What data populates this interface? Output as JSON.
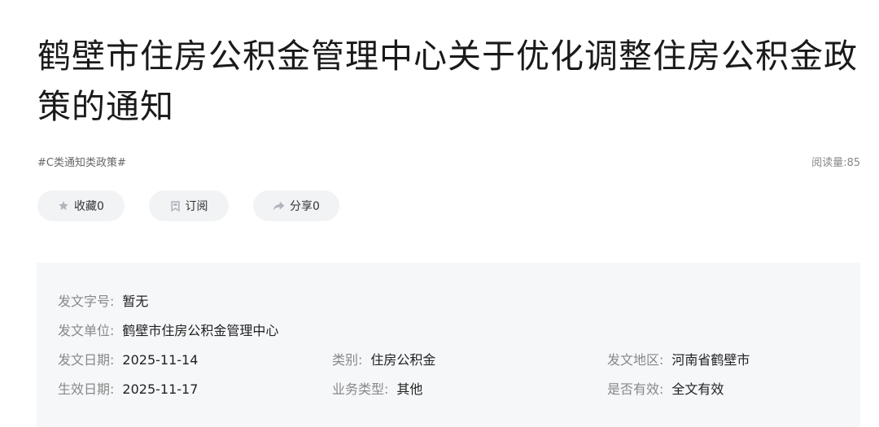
{
  "article": {
    "title": "鹤壁市住房公积金管理中心关于优化调整住房公积金政策的通知",
    "tag": "#C类通知类政策#",
    "read_count": "阅读量:85"
  },
  "actions": {
    "favorite_label": "收藏0",
    "subscribe_label": "订阅",
    "share_label": "分享0"
  },
  "info": {
    "doc_no_label": "发文字号:",
    "doc_no": "暂无",
    "issuer_label": "发文单位:",
    "issuer": "鹤壁市住房公积金管理中心",
    "issue_date_label": "发文日期:",
    "issue_date": "2025-11-14",
    "category_label": "类别:",
    "category": "住房公积金",
    "region_label": "发文地区:",
    "region": "河南省鹤壁市",
    "effective_date_label": "生效日期:",
    "effective_date": "2025-11-17",
    "business_type_label": "业务类型:",
    "business_type": "其他",
    "valid_label": "是否有效:",
    "valid": "全文有效"
  },
  "icons": {
    "favorite": "star-icon",
    "subscribe": "bookmark-icon",
    "share": "share-arrow-icon"
  },
  "colors": {
    "title": "#1a1a1a",
    "label": "#888888",
    "panel_bg": "#f6f7f9",
    "pill_bg": "#f2f3f5",
    "icon": "#b0b4bb"
  }
}
